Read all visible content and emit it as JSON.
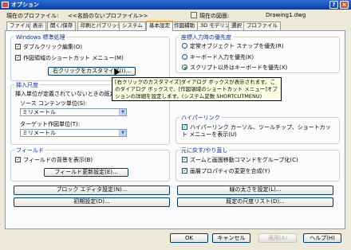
{
  "window": {
    "title": "オプション",
    "help_glyph": "?",
    "close_glyph": "×"
  },
  "info": {
    "profile_label": "現在のプロファイル:",
    "profile_value": "<<名前のないプロファイル>>",
    "drawing_label": "現在の図面:",
    "drawing_value": "Drawing1.dwg"
  },
  "tabs": [
    "ファイル",
    "表示",
    "開く/保存",
    "印刷とパブリッシュ",
    "システム",
    "基本設定",
    "作図補助",
    "3D モデリング",
    "選択",
    "プロファイル"
  ],
  "active_tab": "基本設定",
  "windows_group": {
    "label": "Windows 標準処理",
    "double_click_edit": {
      "label": "ダブルクリック編集(O)",
      "checked": true
    },
    "shortcut_menu": {
      "label": "作図領域のショートカット メニュー(M)",
      "checked": true
    },
    "right_click_button": "右クリックをカスタマイズ(I)..."
  },
  "insert_scale_group": {
    "label": "挿入尺度",
    "desc": "挿入単位が定義されていないときの既定",
    "source_label": "ソース コンテンツ単位(S):",
    "source_value": "ミリメートル",
    "target_label": "ターゲット作図単位(T):",
    "target_value": "ミリメートル"
  },
  "fields_group": {
    "label": "フィールド",
    "show_background": {
      "label": "フィールドの背景を表示(B)",
      "checked": true
    },
    "update_button": "フィールド更新設定(E)..."
  },
  "coord_priority_group": {
    "label": "座標入力時の優先度",
    "options": [
      {
        "label": "定常オブジェクト スナップを優先(R)",
        "selected": false
      },
      {
        "label": "キーボード入力を優先(K)",
        "selected": false
      },
      {
        "label": "スクリプト以外はキーボードを優先(X)",
        "selected": true
      }
    ]
  },
  "hyperlink_group": {
    "label": "ハイパーリンク",
    "show_cursor": {
      "label": "ハイパーリンク カーソル、ツールチップ、ショートカット メニューを表示(U)",
      "checked": true
    }
  },
  "undo_group": {
    "label": "元に戻す/やり直し",
    "group_zoom_pan": {
      "label": "ズームと画面移動コマンドをグループ化(C)",
      "checked": true
    },
    "merge_layer_props": {
      "label": "画層プロパティの変更を合成(Y)",
      "checked": true
    }
  },
  "bottom_buttons": {
    "block_editor": "ブロック エディタ設定(N)...",
    "lineweight": "線の太さを設定(L)...",
    "initial": "初期設定(D)...",
    "scale_list": "既定の尺度リスト(D)..."
  },
  "tooltip": "[右クリックのカスタマイズ]ダイアログ ボックスが表示されます。このダイアログ ボックスで、[作図領域のショートカット メニュー]オプションの詳細を設定します。(システム変数 SHORTCUTMENU)",
  "footer": {
    "ok": "OK",
    "cancel": "キャンセル",
    "apply": "適用(A)",
    "help": "ヘルプ(H)"
  }
}
